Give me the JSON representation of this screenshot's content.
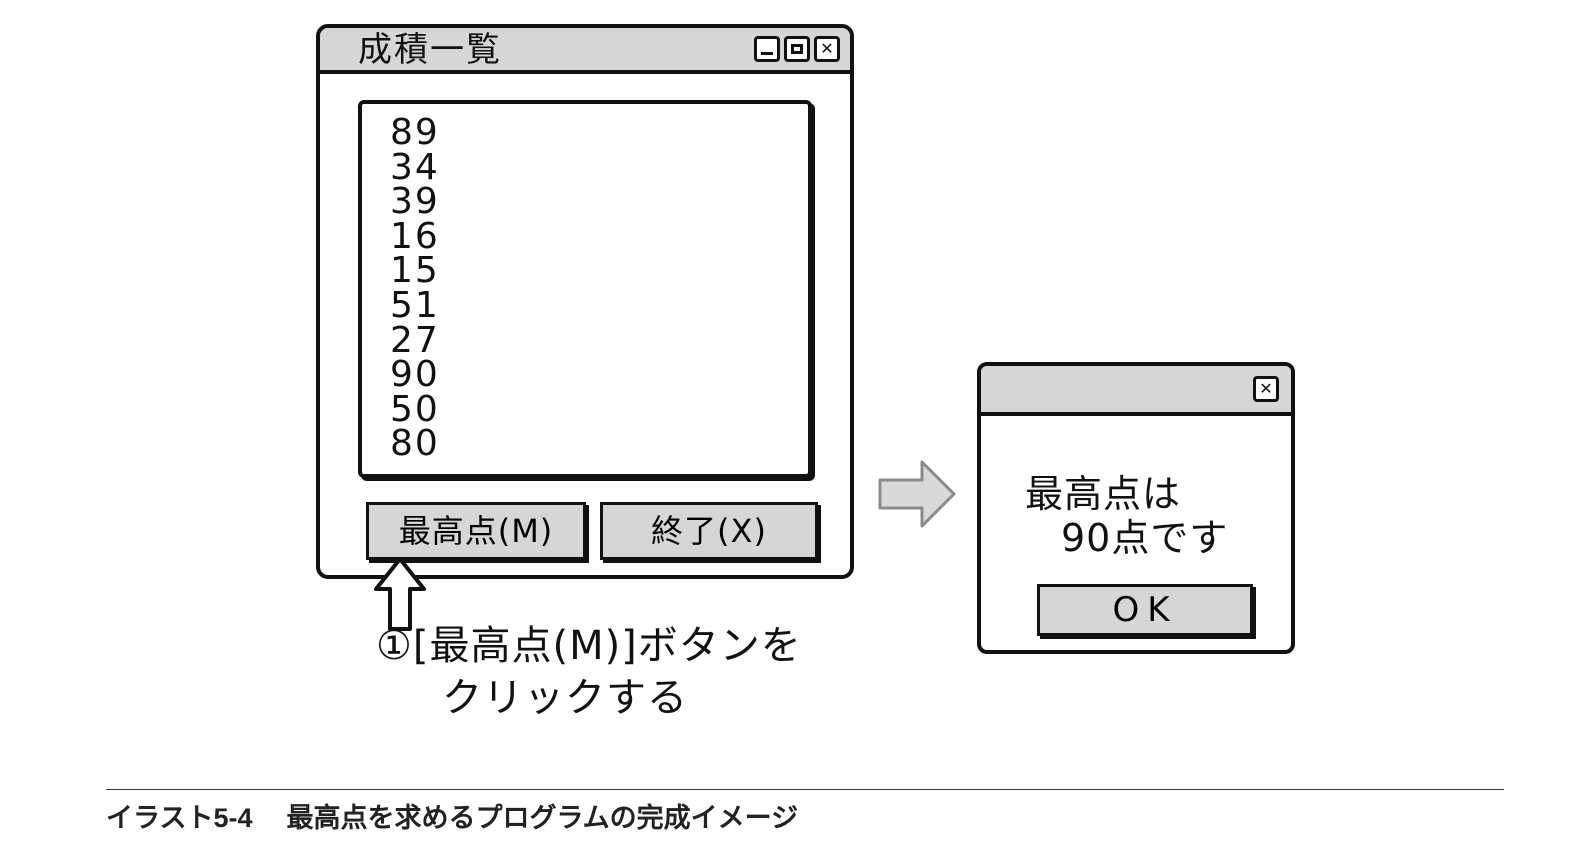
{
  "main_window": {
    "title": "成積一覧",
    "controls": [
      "minimize-icon",
      "maximize-icon",
      "close-icon"
    ],
    "close_glyph": "✕",
    "scores": [
      "89",
      "34",
      "39",
      "16",
      "15",
      "51",
      "27",
      "90",
      "50",
      "80"
    ],
    "max_button_label": "最高点(M)",
    "exit_button_label": "終了(X)"
  },
  "annotation": {
    "line1": "①[最高点(M)]ボタンを",
    "line2": "クリックする"
  },
  "dialog": {
    "close_glyph": "✕",
    "message_line1": "最高点は",
    "message_line2": "90点です",
    "ok_label": "OK"
  },
  "caption": {
    "number": "イラスト5-4",
    "text": "最高点を求めるプログラムの完成イメージ"
  },
  "colors": {
    "titlebar": "#d6d6d6",
    "button": "#d6d6d6",
    "arrow_fill": "#d9d9d9",
    "ink": "#111111"
  }
}
